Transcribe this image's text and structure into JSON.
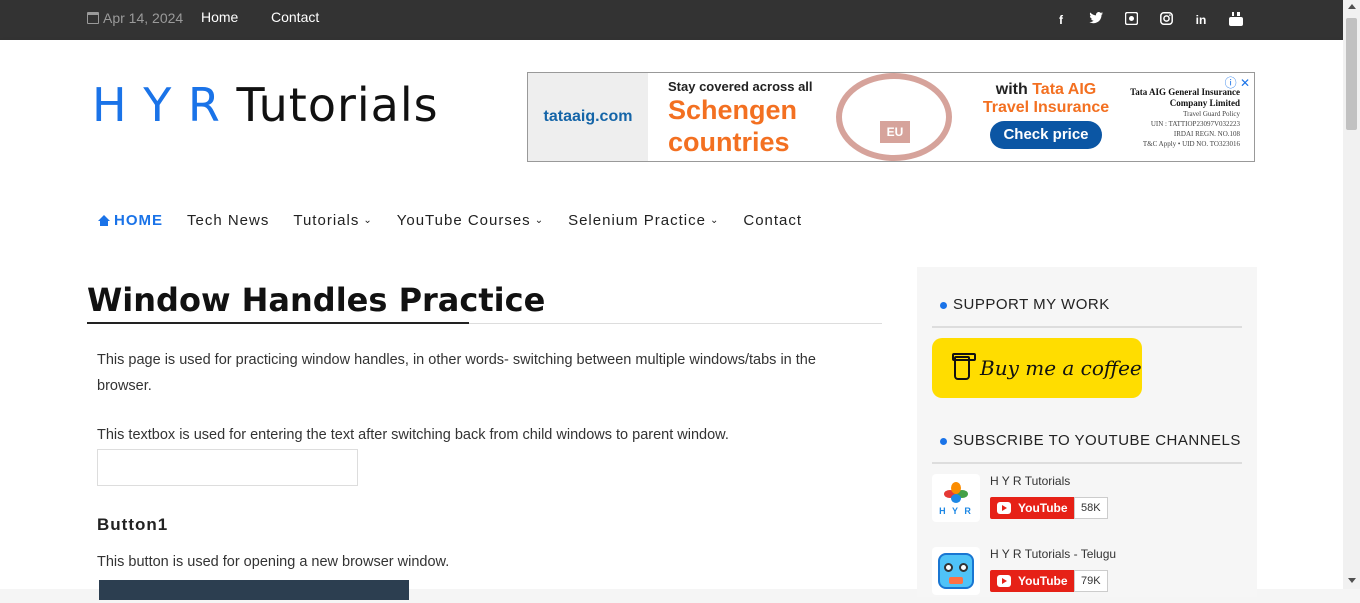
{
  "topbar": {
    "date": "Apr 14, 2024",
    "links": [
      "Home",
      "Contact"
    ],
    "social": [
      "facebook-icon",
      "twitter-icon",
      "github-icon",
      "instagram-icon",
      "linkedin-icon",
      "youtube-icon"
    ]
  },
  "header": {
    "logo_part1": "H Y R",
    "logo_part2": "Tutorials",
    "ad": {
      "brand": "tataaig.com",
      "line1": "Stay covered across all",
      "line2": "Schengen",
      "line3": "countries",
      "stamp": "EU",
      "with_prefix": "with",
      "brand_name": "Tata AIG",
      "product": "Travel Insurance",
      "cta": "Check price",
      "fine_title": "Tata AIG General Insurance Company Limited",
      "fine_1": "Travel Guard Policy",
      "fine_2": "UIN : TATTIOP23097V032223",
      "fine_3": "IRDAI REGN. NO.108",
      "fine_4": "T&C Apply • UID NO. TO323016"
    }
  },
  "nav": {
    "home": "HOME",
    "tech_news": "Tech News",
    "tutorials": "Tutorials",
    "youtube_courses": "YouTube Courses",
    "selenium_practice": "Selenium Practice",
    "contact": "Contact"
  },
  "main": {
    "title": "Window Handles Practice",
    "para1": "This page is used for practicing window handles, in other words- switching between multiple windows/tabs in the browser.",
    "para2": "This textbox is used for entering the text after switching back from child windows to parent window.",
    "textbox_value": "",
    "button1_heading": "Button1",
    "para3": "This button is used for opening a new browser window."
  },
  "sidebar": {
    "support_heading": "SUPPORT MY WORK",
    "coffee_label": "Buy me a coffee",
    "subscribe_heading": "SUBSCRIBE TO YOUTUBE CHANNELS",
    "channels": [
      {
        "name": "H Y R Tutorials",
        "button": "YouTube",
        "count": "58K",
        "avatar_text": "H Y R"
      },
      {
        "name": "H Y R Tutorials - Telugu",
        "button": "YouTube",
        "count": "79K"
      }
    ]
  },
  "colors": {
    "topbar": "#333333",
    "accent": "#1a73e8",
    "coffee": "#ffdd00",
    "youtube": "#e62117"
  }
}
